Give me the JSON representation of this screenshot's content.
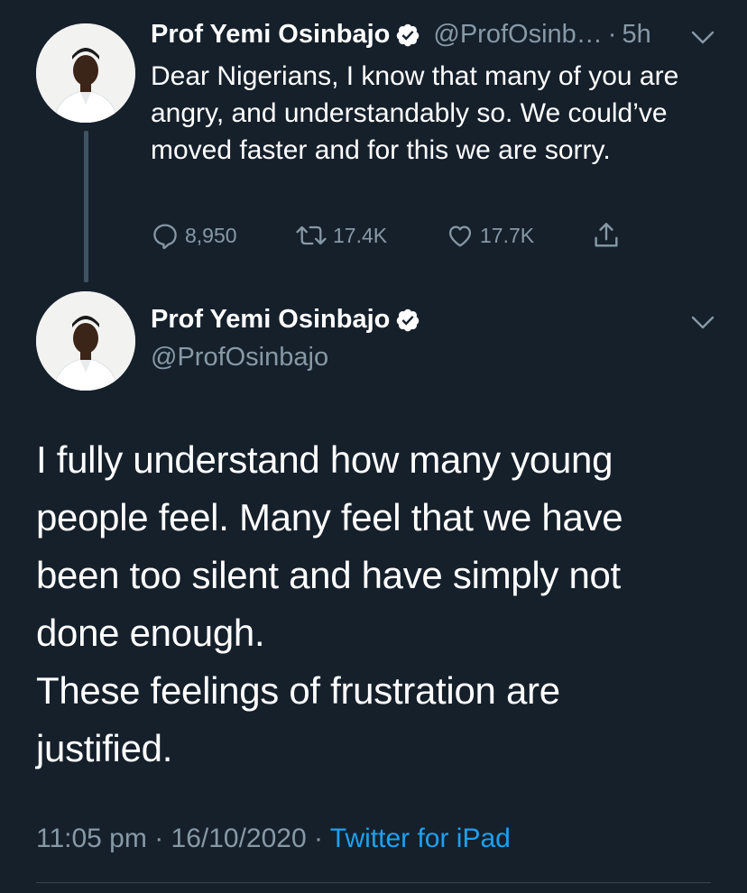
{
  "reply_to": {
    "author_name": "Prof Yemi Osinbajo",
    "handle": "@ProfOsinb…",
    "separator": "·",
    "time": "5h",
    "text": "Dear Nigerians, I know that many of you are angry, and understandably so. We could’ve moved faster and for this we are sorry.",
    "replies": "8,950",
    "retweets": "17.4K",
    "likes": "17.7K"
  },
  "main_tweet": {
    "author_name": "Prof Yemi Osinbajo",
    "handle": "@ProfOsinbajo",
    "text_line1": "I fully understand how many young people feel. Many feel that we have been too silent and have simply not done enough.",
    "text_line2": "These feelings of frustration are justified.",
    "timestamp": "11:05 pm · 16/10/2020 · ",
    "source": "Twitter for iPad"
  },
  "colors": {
    "background": "#15202b",
    "muted": "#8899a6",
    "link": "#1da1f2",
    "verified": "#ffffff"
  }
}
